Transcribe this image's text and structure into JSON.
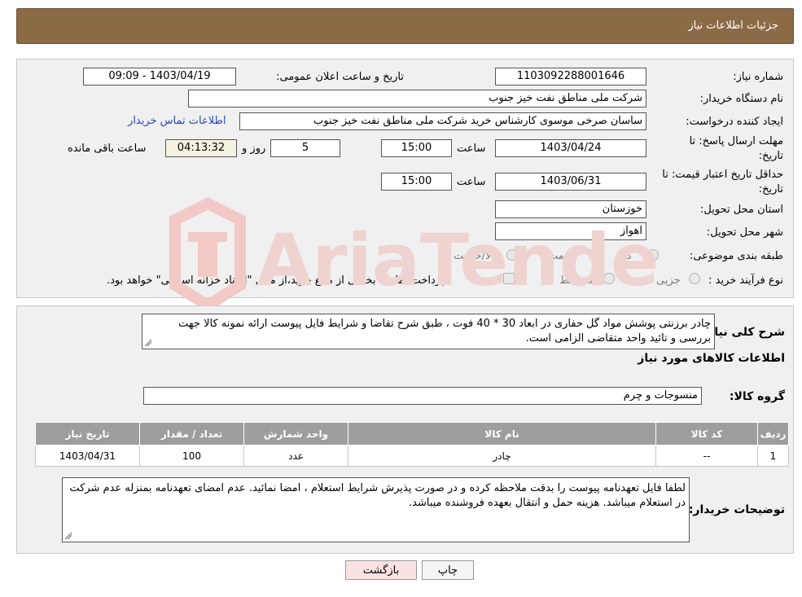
{
  "header": {
    "title": "جزئیات اطلاعات نیاز"
  },
  "form": {
    "need_number_label": "شماره نیاز:",
    "need_number": "1103092288001646",
    "announce_label": "تاریخ و ساعت اعلان عمومی:",
    "announce_value": "1403/04/19 - 09:09",
    "buyer_org_label": "نام دستگاه خریدار:",
    "buyer_org": "شرکت ملی مناطق نفت خیز جنوب",
    "creator_label": "ایجاد کننده درخواست:",
    "creator": "ساسان صرخی موسوی کارشناس خرید  شرکت ملی مناطق نفت خیز جنوب",
    "contact_link": "اطلاعات تماس خریدار",
    "deadline_label_1": "مهلت ارسال پاسخ: تا",
    "deadline_label_2": "تاریخ:",
    "deadline_date": "1403/04/24",
    "time_label": "ساعت",
    "deadline_time": "15:00",
    "days_value": "5",
    "days_label": "روز و",
    "remaining_time": "04:13:32",
    "remaining_label": "ساعت باقی مانده",
    "validity_label_1": "حداقل تاریخ اعتبار قیمت: تا",
    "validity_label_2": "تاریخ:",
    "validity_date": "1403/06/31",
    "validity_time": "15:00",
    "province_label": "استان محل تحویل:",
    "province": "خوزستان",
    "city_label": "شهر محل تحویل:",
    "city": "اهواز",
    "category_label": "طبقه بندی موضوعی:",
    "category_options": [
      "کالا",
      "خدمت",
      "کالا/خدمت"
    ],
    "process_label": "نوع فرآیند خرید :",
    "process_options": [
      "جزیی",
      "متوسط"
    ],
    "process_note": "پرداخت تمام یا بخشی از مبلغ خرید،از محل \"اسناد خزانه اسلامی\" خواهد بود."
  },
  "details": {
    "summary_label": "شرح کلی نیاز:",
    "summary_text": "چادر برزنتی پوشش مواد گل حفاری در ابعاد 30 * 40 فوت ، طبق شرح تقاضا و شرایط فایل پیوست ارائه نمونه کالا جهت بررسی و تائید واحد متقاضی الزامی است.",
    "goods_info_title": "اطلاعات کالاهای مورد نیاز",
    "goods_group_label": "گروه کالا:",
    "goods_group": "منسوجات و چرم",
    "table": {
      "headers": [
        "ردیف",
        "کد کالا",
        "نام کالا",
        "واحد شمارش",
        "تعداد / مقدار",
        "تاریخ نیاز"
      ],
      "rows": [
        [
          "1",
          "--",
          "چادر",
          "عدد",
          "100",
          "1403/04/31"
        ]
      ]
    },
    "buyer_notes_label": "توضیحات خریدار:",
    "buyer_notes": "لطفا فایل تعهدنامه پیوست را بدقت ملاحظه کرده و در صورت پذیرش شرایط استعلام ، امضا نمائید. عدم امضای تعهدنامه بمنزله عدم شرکت در استعلام میباشد. هزینه حمل و انتقال بعهده فروشنده میباشد."
  },
  "buttons": {
    "print": "چاپ",
    "back": "بازگشت"
  },
  "colors": {
    "header_bg": "#8b6a46",
    "link": "#2347c9",
    "table_header": "#9e9e9e",
    "back_button_bg": "#fbe2e2"
  }
}
